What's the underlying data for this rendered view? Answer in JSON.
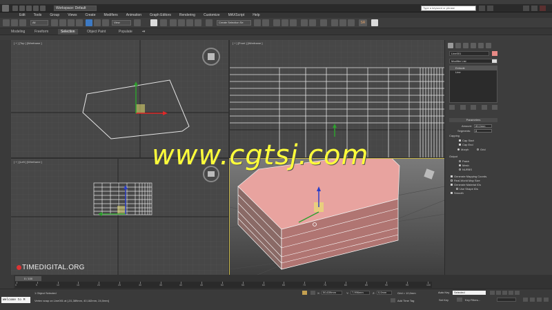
{
  "titlebar": {
    "workspace": "Workspace: Default",
    "search_placeholder": "Type a keyword or phrase"
  },
  "menu": [
    "Edit",
    "Tools",
    "Group",
    "Views",
    "Create",
    "Modifiers",
    "Animation",
    "Graph Editors",
    "Rendering",
    "Customize",
    "MAXScript",
    "Help"
  ],
  "toolbar": {
    "filter_value": "All",
    "ref_coord": "View",
    "named_selection": "Create Selection Se",
    "sr_label": "SR"
  },
  "ribbon": {
    "tabs": [
      "Modeling",
      "Freeform",
      "Selection",
      "Object Paint",
      "Populate"
    ],
    "active_tab": "Selection"
  },
  "viewports": {
    "top": "[ + ] [Top ] [Wireframe ]",
    "front": "[ + ] [Front ] [Wireframe ]",
    "left": "[ + ] [Left ] [Wireframe ]"
  },
  "panel": {
    "object_name": "Line001",
    "object_color": "#e88a86",
    "modifier_list": "Modifier List",
    "stack": [
      "Extrude",
      "Line"
    ],
    "rollout_title": "Parameters",
    "amount_label": "Amount:",
    "amount_value": "80,0mm",
    "segments_label": "Segments:",
    "segments_value": "8",
    "capping_label": "Capping",
    "cap_start": "Cap Start",
    "cap_end": "Cap End",
    "morph": "Morph",
    "grid": "Grid",
    "output_label": "Output",
    "patch": "Patch",
    "mesh": "Mesh",
    "nurbs": "NURBS",
    "gen_mapping": "Generate Mapping Coords.",
    "real_world": "Real-World Map Size",
    "gen_matids": "Generate Material IDs",
    "use_shape_ids": "Use Shape IDs",
    "smooth": "Smooth"
  },
  "timeline": {
    "frame_slider": "0 / 100",
    "ticks": [
      "0",
      "5",
      "10",
      "15",
      "20",
      "25",
      "30",
      "35",
      "40",
      "45",
      "50",
      "55",
      "60",
      "65",
      "70",
      "75",
      "80",
      "85",
      "90",
      "95",
      "100"
    ]
  },
  "status": {
    "listener_text": "Welcome to M",
    "objects_selected": "1 Object Selected",
    "prompt": "Vertex snap on Line001 at [-31,389mm, 40,182mm, 24,0mm]",
    "x_value": "50,639mm",
    "y_value": "7,996mm",
    "z_value": "0,0mm",
    "grid": "Grid = 10,0mm",
    "add_time_tag": "Add Time Tag",
    "auto_key": "Auto Key",
    "set_key": "Set Key",
    "selected": "Selected",
    "key_filters": "Key Filters..."
  },
  "brand": "TIMEDIGITAL.ORG",
  "watermark": "www.cgtsj.com",
  "colors": {
    "solid_fill": "#e88a86",
    "watermark": "#ffff3a",
    "grid_bg": "#474747"
  }
}
